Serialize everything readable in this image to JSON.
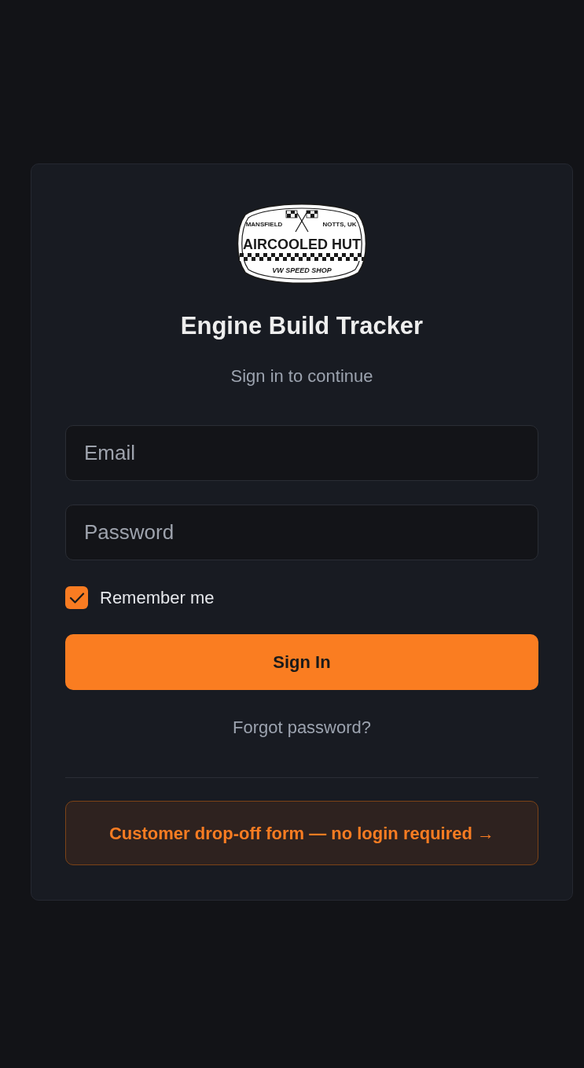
{
  "logo": {
    "left_text": "MANSFIELD",
    "right_text": "NOTTS, UK",
    "name": "AIRCOOLED HUT",
    "tagline": "VW SPEED SHOP"
  },
  "title": "Engine Build Tracker",
  "subtitle": "Sign in to continue",
  "email_field": {
    "placeholder": "Email"
  },
  "password_field": {
    "placeholder": "Password"
  },
  "remember": {
    "label": "Remember me",
    "checked": true
  },
  "sign_in_button": "Sign In",
  "forgot_link": "Forgot password?",
  "dropoff_link": "Customer drop-off form — no login required →"
}
